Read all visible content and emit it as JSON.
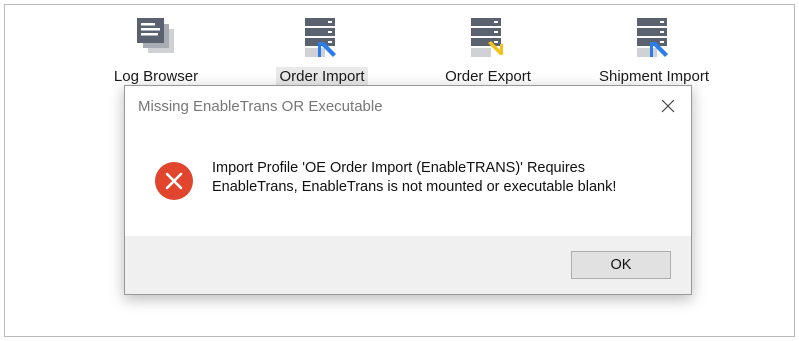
{
  "launchers": [
    {
      "label": "Log Browser",
      "icon": "log-browser-icon"
    },
    {
      "label": "Order Import",
      "icon": "order-import-icon",
      "selected": true
    },
    {
      "label": "Order Export",
      "icon": "order-export-icon"
    },
    {
      "label": "Shipment Import",
      "icon": "shipment-import-icon"
    }
  ],
  "dialog": {
    "title": "Missing EnableTrans OR Executable",
    "message_line1": "Import Profile 'OE Order Import (EnableTRANS)' Requires",
    "message_line2": "EnableTrans, EnableTrans is not mounted or executable blank!",
    "ok_label": "OK",
    "icon": "error-icon",
    "close_icon": "close-icon"
  },
  "colors": {
    "error_red": "#e2452d",
    "server_gray": "#5a6270",
    "arrow_blue": "#2b7de9",
    "arrow_yellow": "#f2c21b",
    "selected_bg": "#e9e9e9",
    "footer_bg": "#f0f0f0"
  }
}
